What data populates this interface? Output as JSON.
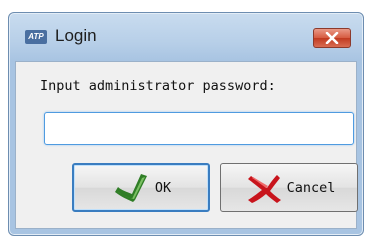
{
  "window": {
    "app_icon_text": "ATP",
    "title": "Login",
    "close_icon": "close-icon"
  },
  "dialog": {
    "prompt": "Input administrator password:",
    "password_value": "",
    "ok_label": "OK",
    "ok_icon": "green-checkmark-icon",
    "cancel_label": "Cancel",
    "cancel_icon": "red-x-icon"
  },
  "colors": {
    "titlebar": "#b7cfe8",
    "close_button": "#d65a40",
    "input_focus_border": "#4f9be0",
    "default_button_border": "#3a7dc0"
  }
}
